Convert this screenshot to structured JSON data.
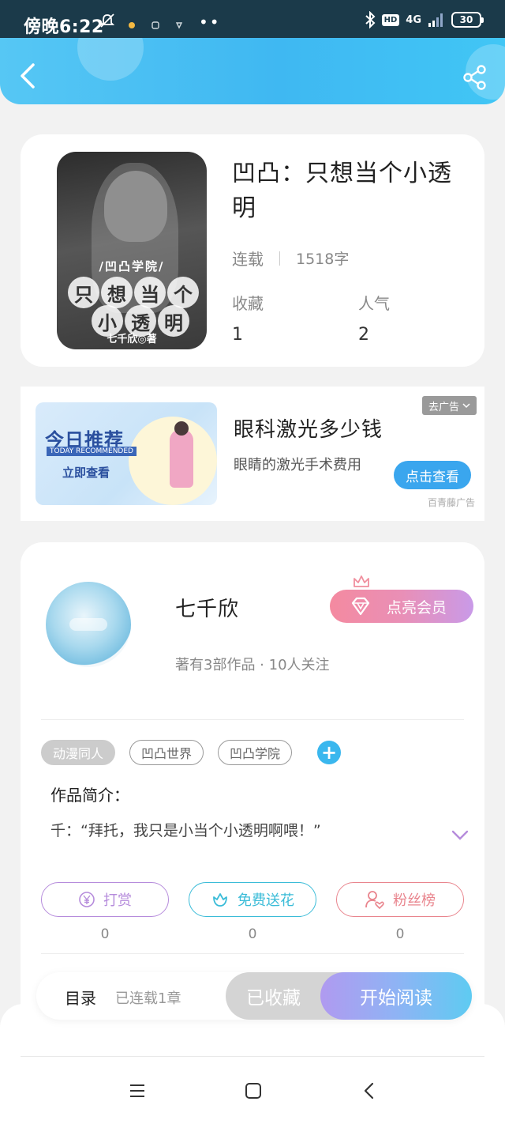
{
  "status_bar": {
    "time": "傍晚6:22",
    "network": "4G",
    "hd": "HD",
    "battery": "30"
  },
  "book": {
    "title": "凹凸：只想当个小透明",
    "status": "连载",
    "word_count": "1518字",
    "stats": [
      {
        "label": "收藏",
        "value": "1"
      },
      {
        "label": "人气",
        "value": "2"
      }
    ],
    "cover": {
      "subtitle": "/凹凸学院/",
      "title_row1": [
        "只",
        "想",
        "当",
        "个"
      ],
      "title_row2": [
        "小",
        "透",
        "明"
      ],
      "author": "七千欣◎著"
    }
  },
  "ad": {
    "banner_title": "今日推荐",
    "banner_subtitle": "TODAY RECOMMENDED",
    "banner_cta": "立即查看",
    "title": "眼科激光多少钱",
    "description": "眼睛的激光手术费用",
    "close_label": "去广告",
    "cta_label": "点击查看",
    "source": "百青藤广告"
  },
  "author": {
    "name": "七千欣",
    "meta": "著有3部作品 · 10人关注",
    "vip_label": "点亮会员"
  },
  "tags": [
    "动漫同人",
    "凹凸世界",
    "凹凸学院"
  ],
  "intro": {
    "label": "作品简介：",
    "text": "千：“拜托，我只是小当个小透明啊喂！”"
  },
  "actions": [
    {
      "label": "打赏",
      "count": "0",
      "color": "#b68cdc",
      "icon": "yen-coin-icon"
    },
    {
      "label": "免费送花",
      "count": "0",
      "color": "#3bbcd8",
      "icon": "flower-icon"
    },
    {
      "label": "粉丝榜",
      "count": "0",
      "color": "#e9858e",
      "icon": "fan-user-icon"
    }
  ],
  "bottom_bar": {
    "toc_label": "目录",
    "toc_count": "已连载1章",
    "collected_label": "已收藏",
    "read_label": "开始阅读"
  },
  "colors": {
    "header_gradient": "#3fb8f2",
    "accent_blue": "#3ab7ee"
  }
}
